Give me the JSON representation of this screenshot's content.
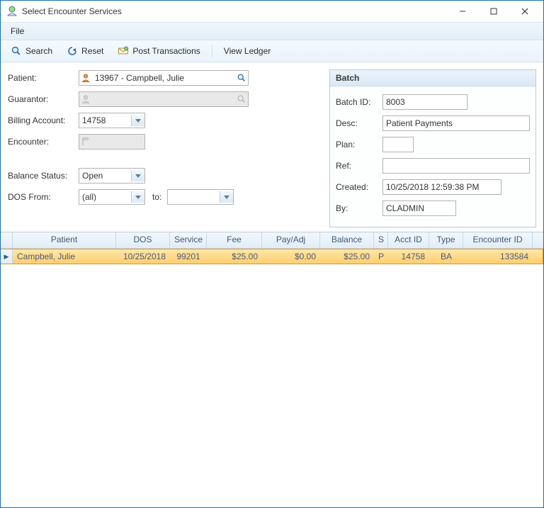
{
  "window": {
    "title": "Select Encounter Services"
  },
  "menubar": {
    "file": "File"
  },
  "toolbar": {
    "search": "Search",
    "reset": "Reset",
    "post_transactions": "Post Transactions",
    "view_ledger": "View Ledger"
  },
  "form": {
    "labels": {
      "patient": "Patient:",
      "guarantor": "Guarantor:",
      "billing_account": "Billing Account:",
      "encounter": "Encounter:",
      "balance_status": "Balance Status:",
      "dos_from": "DOS From:",
      "to": "to:"
    },
    "patient_value": "13967 - Campbell, Julie",
    "guarantor_value": "",
    "billing_account_value": "14758",
    "encounter_value": "",
    "balance_status_value": "Open",
    "dos_from_value": "(all)",
    "dos_to_value": ""
  },
  "batch": {
    "header": "Batch",
    "labels": {
      "batch_id": "Batch ID:",
      "desc": "Desc:",
      "plan": "Plan:",
      "ref": "Ref:",
      "created": "Created:",
      "by": "By:"
    },
    "batch_id": "8003",
    "desc": "Patient Payments",
    "plan": "",
    "ref": "",
    "created": "10/25/2018 12:59:38 PM",
    "by": "CLADMIN"
  },
  "grid": {
    "columns": {
      "patient": "Patient",
      "dos": "DOS",
      "service": "Service",
      "fee": "Fee",
      "payadj": "Pay/Adj",
      "balance": "Balance",
      "s": "S",
      "acct": "Acct ID",
      "type": "Type",
      "enc": "Encounter ID"
    },
    "rows": [
      {
        "patient": "Campbell, Julie",
        "dos": "10/25/2018",
        "service": "99201",
        "fee": "$25.00",
        "payadj": "$0.00",
        "balance": "$25.00",
        "s": "P",
        "acct": "14758",
        "type": "BA",
        "enc": "133584"
      }
    ]
  }
}
